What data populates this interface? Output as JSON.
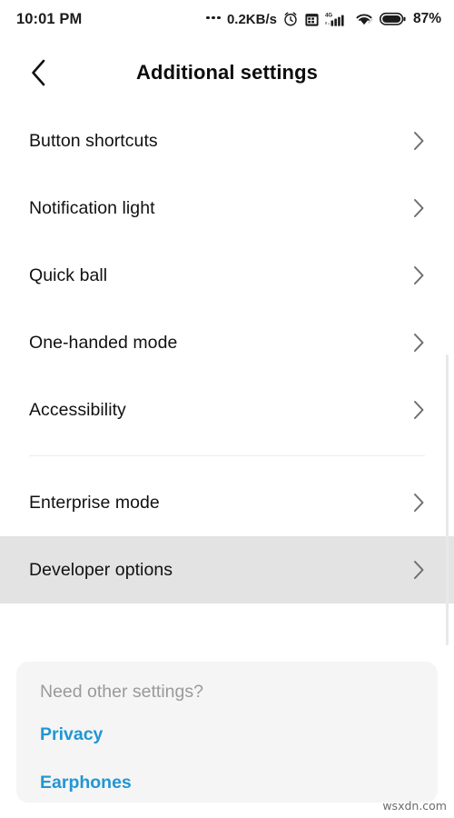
{
  "status_bar": {
    "time": "10:01 PM",
    "network_speed": "0.2KB/s",
    "battery_percent": "87%",
    "icons": [
      "alarm-clock-icon",
      "calendar-icon",
      "signal-4g-icon",
      "wifi-icon",
      "battery-icon"
    ]
  },
  "header": {
    "title": "Additional settings",
    "back_label": "Back"
  },
  "list": {
    "group_one": [
      {
        "label": "Button shortcuts"
      },
      {
        "label": "Notification light"
      },
      {
        "label": "Quick ball"
      },
      {
        "label": "One-handed mode"
      },
      {
        "label": "Accessibility"
      }
    ],
    "group_two": [
      {
        "label": "Enterprise mode",
        "pressed": false
      },
      {
        "label": "Developer options",
        "pressed": true
      }
    ]
  },
  "card": {
    "heading": "Need other settings?",
    "links": [
      {
        "label": "Privacy"
      },
      {
        "label": "Earphones"
      }
    ]
  },
  "watermark": {
    "text": "wsxdn.com"
  },
  "colors": {
    "accent_link": "#2196d3",
    "pressed_row": "#e3e3e3",
    "card_bg": "#f5f5f5",
    "divider": "#ececec",
    "text_primary": "#111111",
    "text_muted": "#9a9a9a",
    "chevron": "#6e6e6e"
  }
}
